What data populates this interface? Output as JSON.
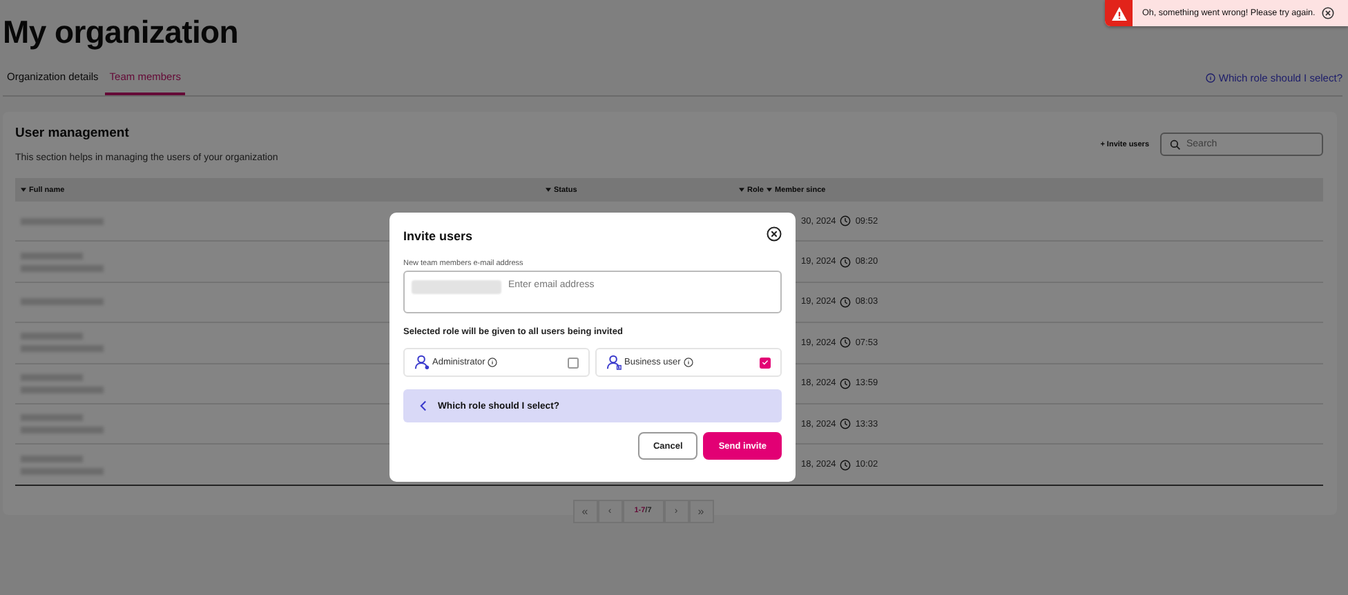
{
  "page": {
    "title": "My organization"
  },
  "tabs": [
    {
      "label": "Organization details",
      "selected": false
    },
    {
      "label": "Team members",
      "selected": true
    }
  ],
  "help_link": "Which role should I select?",
  "toast": {
    "kind": "error",
    "message": "Oh, something went wrong! Please try again."
  },
  "card": {
    "title": "User management",
    "description": "This section helps in managing the users of your organization",
    "invite_link": "+ Invite users",
    "search": {
      "placeholder": "Search"
    }
  },
  "table": {
    "columns": [
      {
        "label": "Full name"
      },
      {
        "label": "Status"
      },
      {
        "label": "Role"
      },
      {
        "label": "Member since"
      }
    ],
    "rows": [
      {
        "name_redacted": [
          {
            "kind": "email"
          }
        ],
        "date": "30, 2024",
        "time": "09:52"
      },
      {
        "name_redacted": [
          {
            "kind": "name"
          },
          {
            "kind": "email"
          }
        ],
        "date": "19, 2024",
        "time": "08:20"
      },
      {
        "name_redacted": [
          {
            "kind": "email"
          }
        ],
        "date": "19, 2024",
        "time": "08:03"
      },
      {
        "name_redacted": [
          {
            "kind": "name"
          },
          {
            "kind": "email"
          }
        ],
        "date": "19, 2024",
        "time": "07:53"
      },
      {
        "name_redacted": [
          {
            "kind": "name"
          },
          {
            "kind": "email"
          }
        ],
        "date": "18, 2024",
        "time": "13:59"
      },
      {
        "name_redacted": [
          {
            "kind": "name"
          },
          {
            "kind": "email"
          }
        ],
        "date": "18, 2024",
        "time": "13:33"
      },
      {
        "name_redacted": [
          {
            "kind": "name"
          },
          {
            "kind": "email"
          }
        ],
        "date": "18, 2024",
        "time": "10:02"
      }
    ]
  },
  "pagination": {
    "buttons": [
      {
        "kind": "first",
        "glyph": "«"
      },
      {
        "kind": "prev",
        "glyph": "‹"
      },
      {
        "kind": "next",
        "glyph": "›"
      },
      {
        "kind": "last",
        "glyph": "»"
      }
    ],
    "range": "1-7",
    "total": "/7"
  },
  "dialog": {
    "title": "Invite users",
    "field_label": "New team members e-mail address",
    "field": {
      "chips": [
        {
          "kind": "redacted"
        }
      ],
      "placeholder": "Enter email address"
    },
    "role_hint": "Selected role will be given to all users being invited",
    "roles": [
      {
        "kind": "admin",
        "label": "Administrator",
        "checked": false
      },
      {
        "kind": "business",
        "label": "Business user",
        "checked": true
      }
    ],
    "info_panel": {
      "text": "Which role should I select?",
      "expanded": false
    },
    "buttons": [
      {
        "kind": "secondary",
        "label": "Cancel"
      },
      {
        "kind": "primary",
        "label": "Send invite"
      }
    ]
  }
}
